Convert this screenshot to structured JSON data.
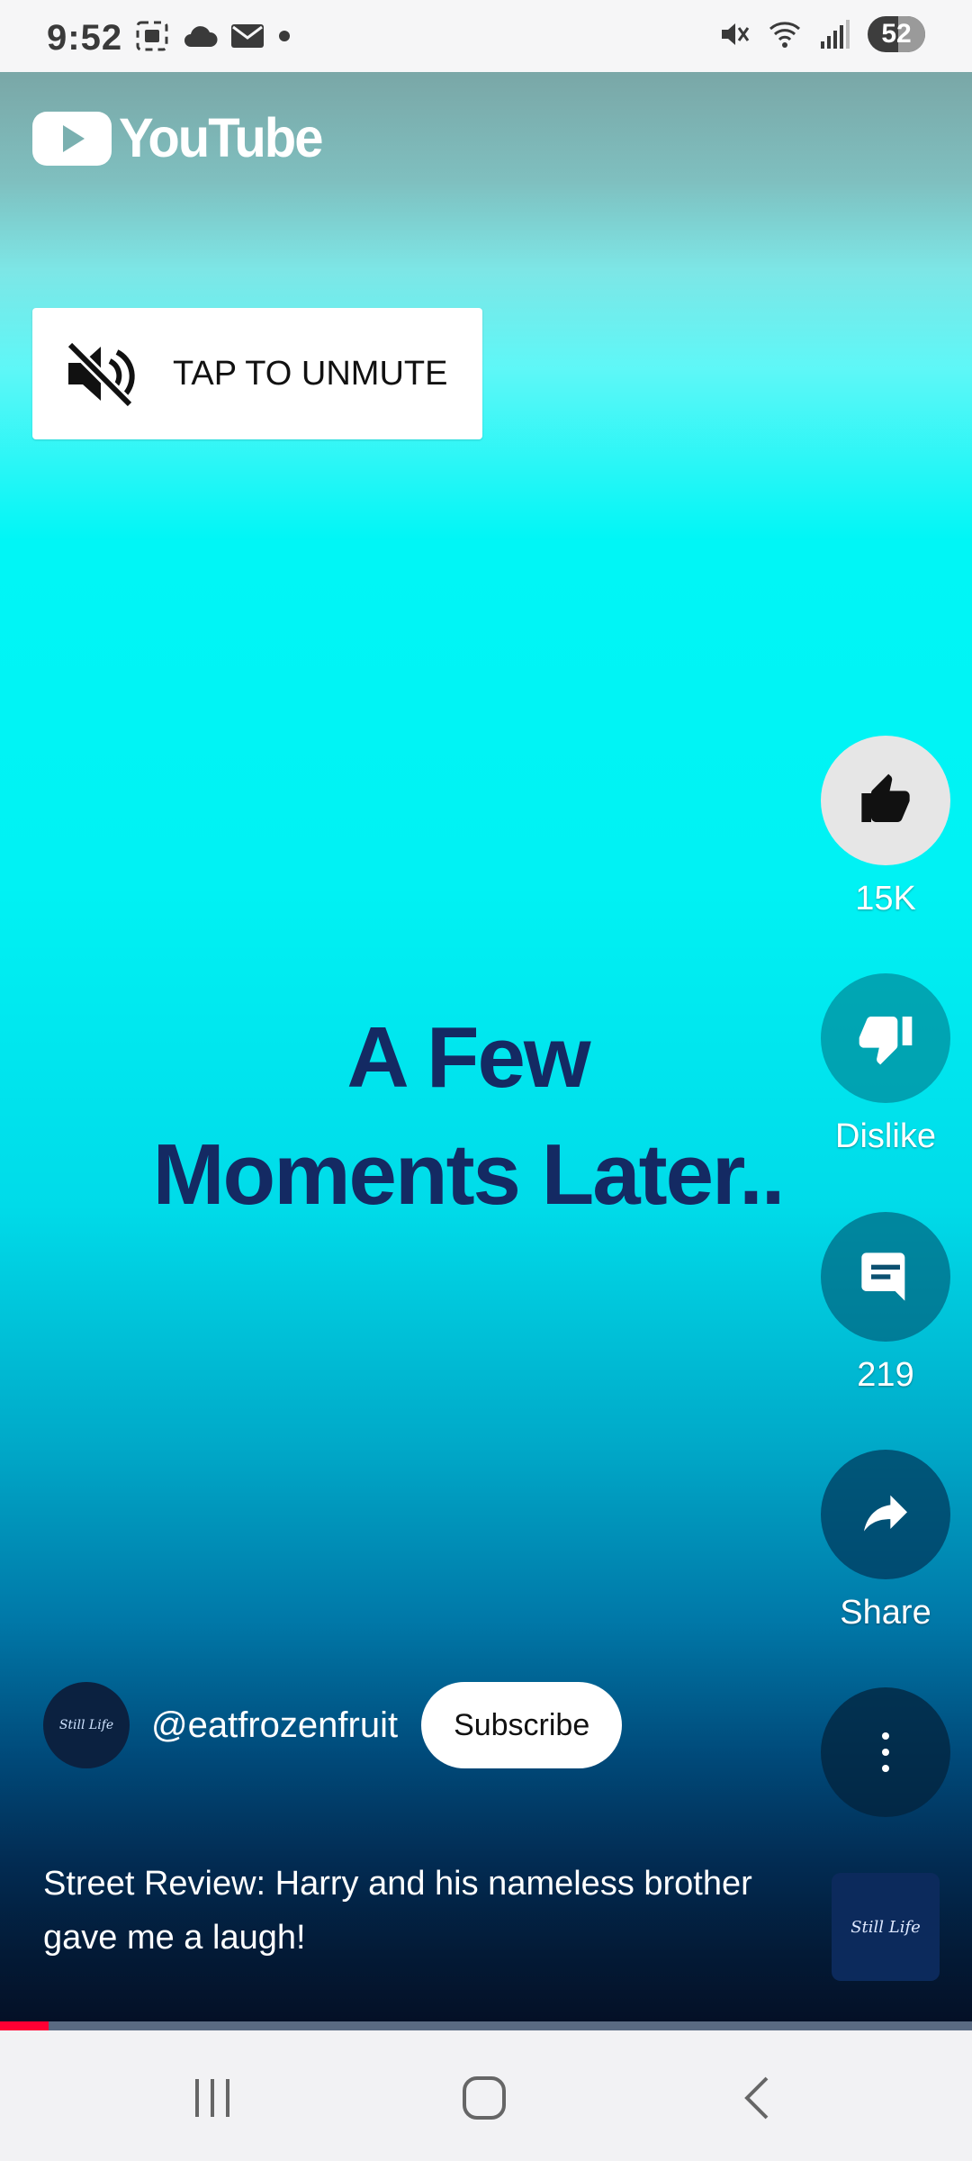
{
  "status_bar": {
    "time": "9:52",
    "battery": "52"
  },
  "app": {
    "logo_text": "YouTube"
  },
  "unmute": {
    "label": "TAP TO UNMUTE"
  },
  "video_overlay": {
    "line1": "A Few",
    "line2": "Moments Later.."
  },
  "actions": {
    "like_count": "15K",
    "dislike_label": "Dislike",
    "comment_count": "219",
    "share_label": "Share"
  },
  "channel": {
    "avatar_text": "Still Life",
    "handle": "@eatfrozenfruit",
    "subscribe_label": "Subscribe"
  },
  "video": {
    "caption": "Street Review: Harry and his nameless brother gave me a laugh!",
    "sound_thumb_text": "Still Life",
    "progress_fraction": 0.05
  },
  "colors": {
    "progress_played": "#ff0033",
    "overlay_text": "#142a63"
  },
  "icons": [
    "screenshot-icon",
    "cloud-icon",
    "mail-icon",
    "mute-status-icon",
    "wifi-icon",
    "signal-icon",
    "play-logo-icon",
    "volume-off-icon",
    "thumb-up-icon",
    "thumb-down-icon",
    "comment-icon",
    "share-arrow-icon",
    "more-vert-icon",
    "recents-icon",
    "home-icon",
    "back-icon"
  ]
}
